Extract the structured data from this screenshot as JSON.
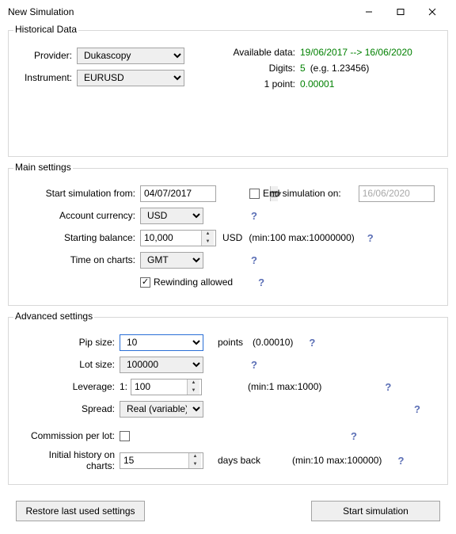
{
  "window": {
    "title": "New Simulation"
  },
  "historical": {
    "legend": "Historical Data",
    "providerLabel": "Provider:",
    "providerValue": "Dukascopy",
    "instrumentLabel": "Instrument:",
    "instrumentValue": "EURUSD",
    "availableLabel": "Available data:",
    "availableValue": "19/06/2017 --> 16/06/2020",
    "digitsLabel": "Digits:",
    "digitsValue": "5",
    "digitsHint": "(e.g. 1.23456)",
    "pointLabel": "1 point:",
    "pointValue": "0.00001"
  },
  "main": {
    "legend": "Main settings",
    "startFromLabel": "Start simulation from:",
    "startFromValue": "04/07/2017",
    "endOnLabel": "End simulation on:",
    "endOnValue": "16/06/2020",
    "currencyLabel": "Account currency:",
    "currencyValue": "USD",
    "balanceLabel": "Starting balance:",
    "balanceValue": "10,000",
    "balanceUnit": "USD",
    "balanceHint": "(min:100  max:10000000)",
    "timeLabel": "Time on charts:",
    "timeValue": "GMT",
    "rewindLabel": "Rewinding allowed"
  },
  "advanced": {
    "legend": "Advanced settings",
    "pipLabel": "Pip size:",
    "pipValue": "10",
    "pipUnit": "points",
    "pipExtra": "(0.00010)",
    "lotLabel": "Lot size:",
    "lotValue": "100000",
    "levLabel": "Leverage:",
    "levPrefix": "1:",
    "levValue": "100",
    "levHint": "(min:1  max:1000)",
    "spreadLabel": "Spread:",
    "spreadValue": "Real (variable)",
    "commLabel": "Commission per lot:",
    "histLabel": "Initial history on charts:",
    "histValue": "15",
    "histUnit": "days back",
    "histHint": "(min:10  max:100000)"
  },
  "buttons": {
    "restore": "Restore last used settings",
    "start": "Start simulation"
  },
  "help": "?"
}
